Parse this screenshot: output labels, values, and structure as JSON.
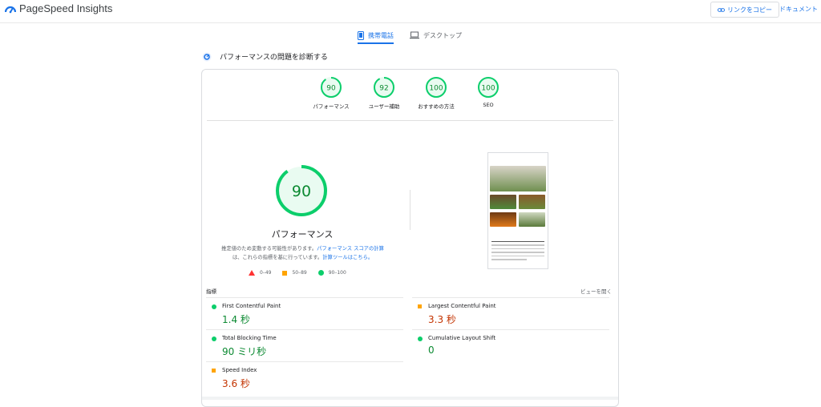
{
  "header": {
    "title": "PageSpeed Insights",
    "copy_link_label": "リンクをコピー",
    "docs_label": "ドキュメント"
  },
  "tabs": [
    {
      "label": "携帯電話",
      "icon": "phone-icon",
      "active": true
    },
    {
      "label": "デスクトップ",
      "icon": "laptop-icon",
      "active": false
    }
  ],
  "section": {
    "title": "パフォーマンスの問題を診断する"
  },
  "categories": [
    {
      "label": "パフォーマンス",
      "score": "90"
    },
    {
      "label": "ユーザー補助",
      "score": "92"
    },
    {
      "label": "おすすめの方法",
      "score": "100"
    },
    {
      "label": "SEO",
      "score": "100"
    }
  ],
  "main_gauge": {
    "score": "90",
    "label": "パフォーマンス"
  },
  "note": {
    "part1": "推定値のため変動する可能性があります。",
    "link1": "パフォーマンス スコアの計算",
    "part2": "は、これらの指標を基に行っています。",
    "link2": "計算ツールはこちら。"
  },
  "legend": [
    "0–49",
    "50–89",
    "90–100"
  ],
  "metrics": {
    "header": "指標",
    "expand_label": "ビューを開く",
    "items": [
      {
        "name": "First Contentful Paint",
        "value": "1.4 秒",
        "status": "good"
      },
      {
        "name": "Largest Contentful Paint",
        "value": "3.3 秒",
        "status": "average"
      },
      {
        "name": "Total Blocking Time",
        "value": "90 ミリ秒",
        "status": "good"
      },
      {
        "name": "Cumulative Layout Shift",
        "value": "0",
        "status": "good"
      },
      {
        "name": "Speed Index",
        "value": "3.6 秒",
        "status": "average"
      }
    ]
  },
  "colors": {
    "good": "#0cce6b",
    "average": "#ffa400",
    "poor": "#ff3333",
    "accent": "#1a73e8"
  }
}
